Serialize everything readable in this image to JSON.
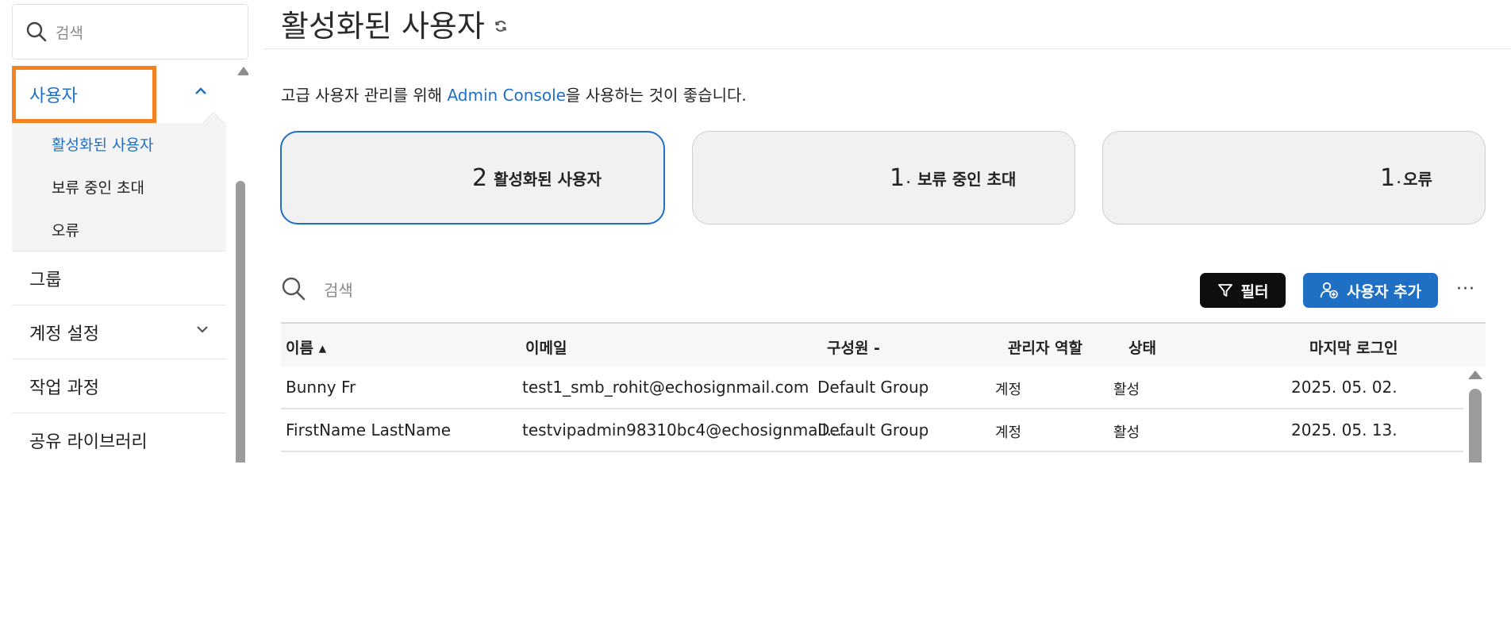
{
  "sidebar": {
    "search_placeholder": "검색",
    "users": {
      "label": "사용자"
    },
    "sub_items": [
      "활성화된 사용자",
      "보류 중인 초대",
      "오류"
    ],
    "items": [
      {
        "label": "그룹"
      },
      {
        "label": "계정 설정"
      },
      {
        "label": "작업 과정"
      },
      {
        "label": "공유 라이브러리"
      }
    ]
  },
  "main": {
    "title": "활성화된 사용자",
    "notice_prefix": "고급 사용자 관리를 위해 ",
    "notice_link": "Admin Console",
    "notice_suffix": "을 사용하는 것이 좋습니다.",
    "cards": [
      {
        "count": "2",
        "label": "활성화된 사용자"
      },
      {
        "count": "1",
        "label": "보류 중인 초대"
      },
      {
        "count": "1",
        "label": "오류"
      }
    ],
    "table_search_placeholder": "검색",
    "filter_label": "필터",
    "add_user_label": "사용자 추가",
    "more_label": "···",
    "columns": [
      "이름 ▴",
      "이메일",
      "구성원 -",
      "관리자 역할",
      "상태",
      "마지막 로그인"
    ],
    "rows": [
      {
        "name": "Bunny Fr",
        "email": "test1_smb_rohit@echosignmail.com",
        "group": "Default Group",
        "role": "계정",
        "status": "활성",
        "last_login": "2025. 05. 02."
      },
      {
        "name": "FirstName LastName",
        "email": "testvipadmin98310bc4@echosignmail....",
        "group": "Default Group",
        "role": "계정",
        "status": "활성",
        "last_login": "2025. 05. 13."
      }
    ]
  },
  "colors": {
    "accent": "#1f6fc4",
    "highlight": "#f5821f",
    "primary_button": "#0e0e0e"
  }
}
